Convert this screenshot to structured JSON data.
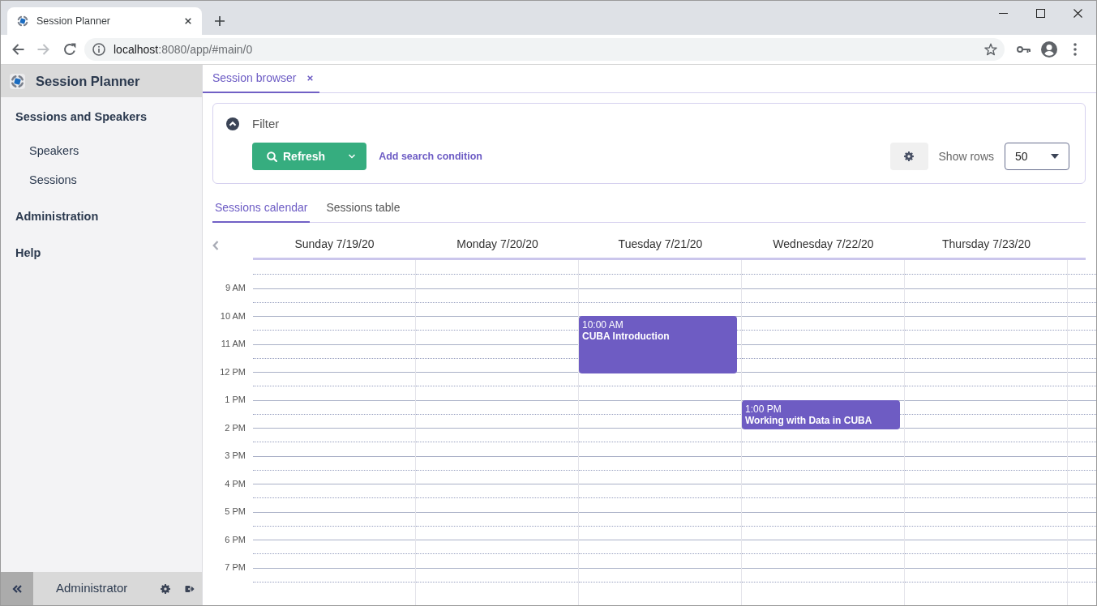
{
  "browser": {
    "tab_title": "Session Planner",
    "url_host": "localhost",
    "url_path": ":8080/app/#main/0",
    "nav_buttons": [
      {
        "kind": "back",
        "disabled": false
      },
      {
        "kind": "forward",
        "disabled": true
      },
      {
        "kind": "reload",
        "disabled": false
      }
    ]
  },
  "sidebar": {
    "app_title": "Session Planner",
    "menu": [
      {
        "label": "Sessions and Speakers",
        "children": [
          {
            "label": "Speakers"
          },
          {
            "label": "Sessions"
          }
        ]
      },
      {
        "label": "Administration"
      },
      {
        "label": "Help"
      }
    ],
    "user_name": "Administrator"
  },
  "main_tabs": [
    {
      "label": "Session browser",
      "selected": true
    }
  ],
  "filter": {
    "title": "Filter",
    "expanded": true,
    "refresh_button": "Refresh",
    "add_condition_link": "Add search condition",
    "show_rows_label": "Show rows",
    "show_rows_value": "50"
  },
  "view_tabs": [
    {
      "label": "Sessions calendar",
      "selected": true
    },
    {
      "label": "Sessions table",
      "selected": false
    }
  ],
  "calendar": {
    "days": [
      {
        "label": "Sunday 7/19/20"
      },
      {
        "label": "Monday 7/20/20"
      },
      {
        "label": "Tuesday 7/21/20",
        "events": [
          {
            "kind": "long",
            "time": "10:00 AM",
            "title": "CUBA Introduction"
          }
        ]
      },
      {
        "label": "Wednesday 7/22/20",
        "events": [
          {
            "kind": "short",
            "time": "1:00 PM",
            "title": "Working with Data in CUBA"
          }
        ]
      },
      {
        "label": "Thursday 7/23/20"
      }
    ],
    "hours": [
      "9 AM",
      "10 AM",
      "11 AM",
      "12 PM",
      "1 PM",
      "2 PM",
      "3 PM",
      "4 PM",
      "5 PM",
      "6 PM",
      "7 PM"
    ]
  }
}
